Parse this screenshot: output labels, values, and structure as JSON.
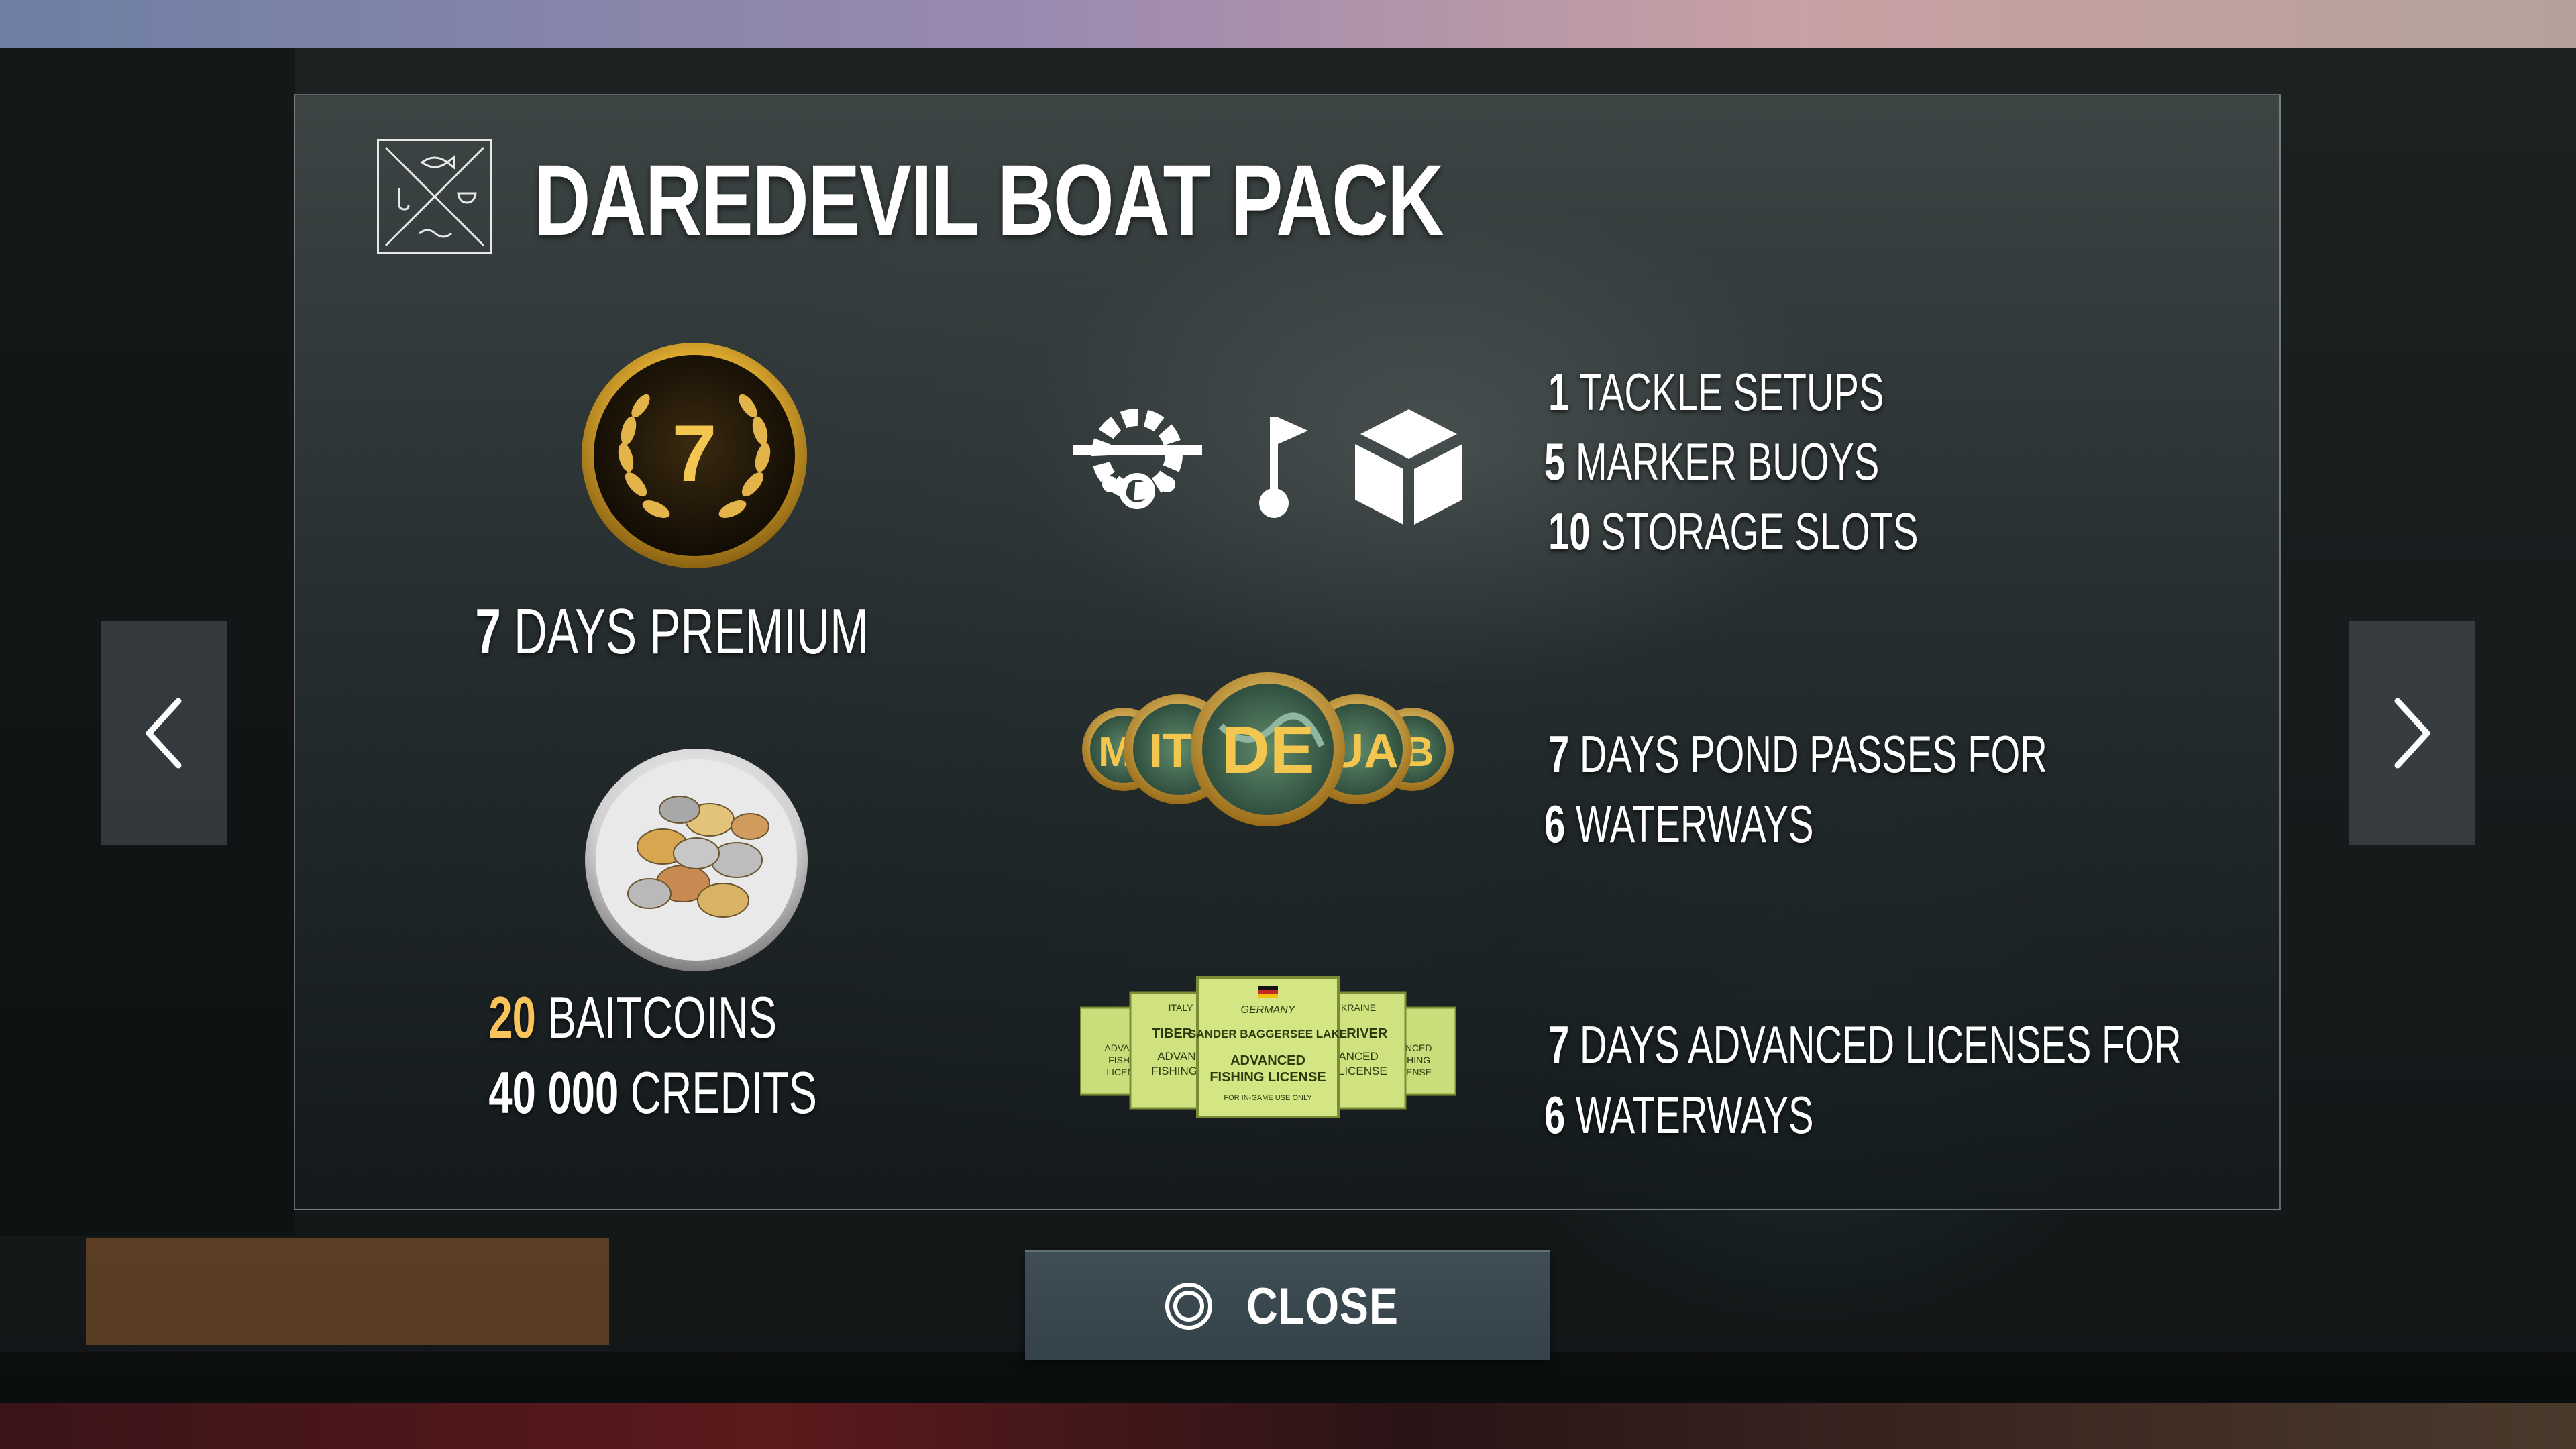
{
  "title": "DAREDEVIL BOAT PACK",
  "premium": {
    "badge_number": "7",
    "amount": "7",
    "label": "DAYS PREMIUM"
  },
  "currency": [
    {
      "amount": "20",
      "label": "BAITCOINS",
      "color": "#f6c45a"
    },
    {
      "amount": "40 000",
      "label": "CREDITS",
      "color": "#ffffff"
    }
  ],
  "feature_icons": [
    "tackle-gear-icon",
    "marker-buoy-icon",
    "storage-box-icon"
  ],
  "features": [
    {
      "amount": "1",
      "label": "TACKLE SETUPS"
    },
    {
      "amount": "5",
      "label": "MARKER BUOYS"
    },
    {
      "amount": "10",
      "label": "STORAGE SLOTS"
    }
  ],
  "pond_passes": {
    "medals": [
      "M",
      "IT",
      "DE",
      "UA",
      "B"
    ],
    "line1": {
      "amount": "7",
      "label": "DAYS POND PASSES FOR"
    },
    "line2": {
      "amount": "6",
      "label": "WATERWAYS"
    }
  },
  "licenses": {
    "center_card": {
      "country": "GERMANY",
      "water": "SANDER BAGGERSEE LAKE",
      "type": "ADVANCED",
      "name": "FISHING LICENSE",
      "footer": "FOR IN-GAME USE ONLY"
    },
    "left_card": {
      "country": "ITALY",
      "water": "TIBER RI",
      "type": "ADVANC",
      "name": "FISHING LI"
    },
    "right_card": {
      "country": "UKRAINE",
      "water": "RO RIVER",
      "type": "VANCED",
      "name": "IG LICENSE"
    },
    "far_left_card": {
      "type": "ADVAN",
      "name": "FISHI",
      "extra": "LICEN"
    },
    "far_right_card": {
      "type": "ANCED",
      "name": "SHING",
      "extra": "CENSE"
    },
    "line1": {
      "amount": "7",
      "label": "DAYS ADVANCED LICENSES FOR"
    },
    "line2": {
      "amount": "6",
      "label": "WATERWAYS"
    }
  },
  "buttons": {
    "close": "CLOSE",
    "prev_icon": "chevron-left-icon",
    "next_icon": "chevron-right-icon"
  },
  "colors": {
    "gold": "#f6c45a",
    "license_green": "#c9dd7a",
    "button": "#3a4850"
  }
}
